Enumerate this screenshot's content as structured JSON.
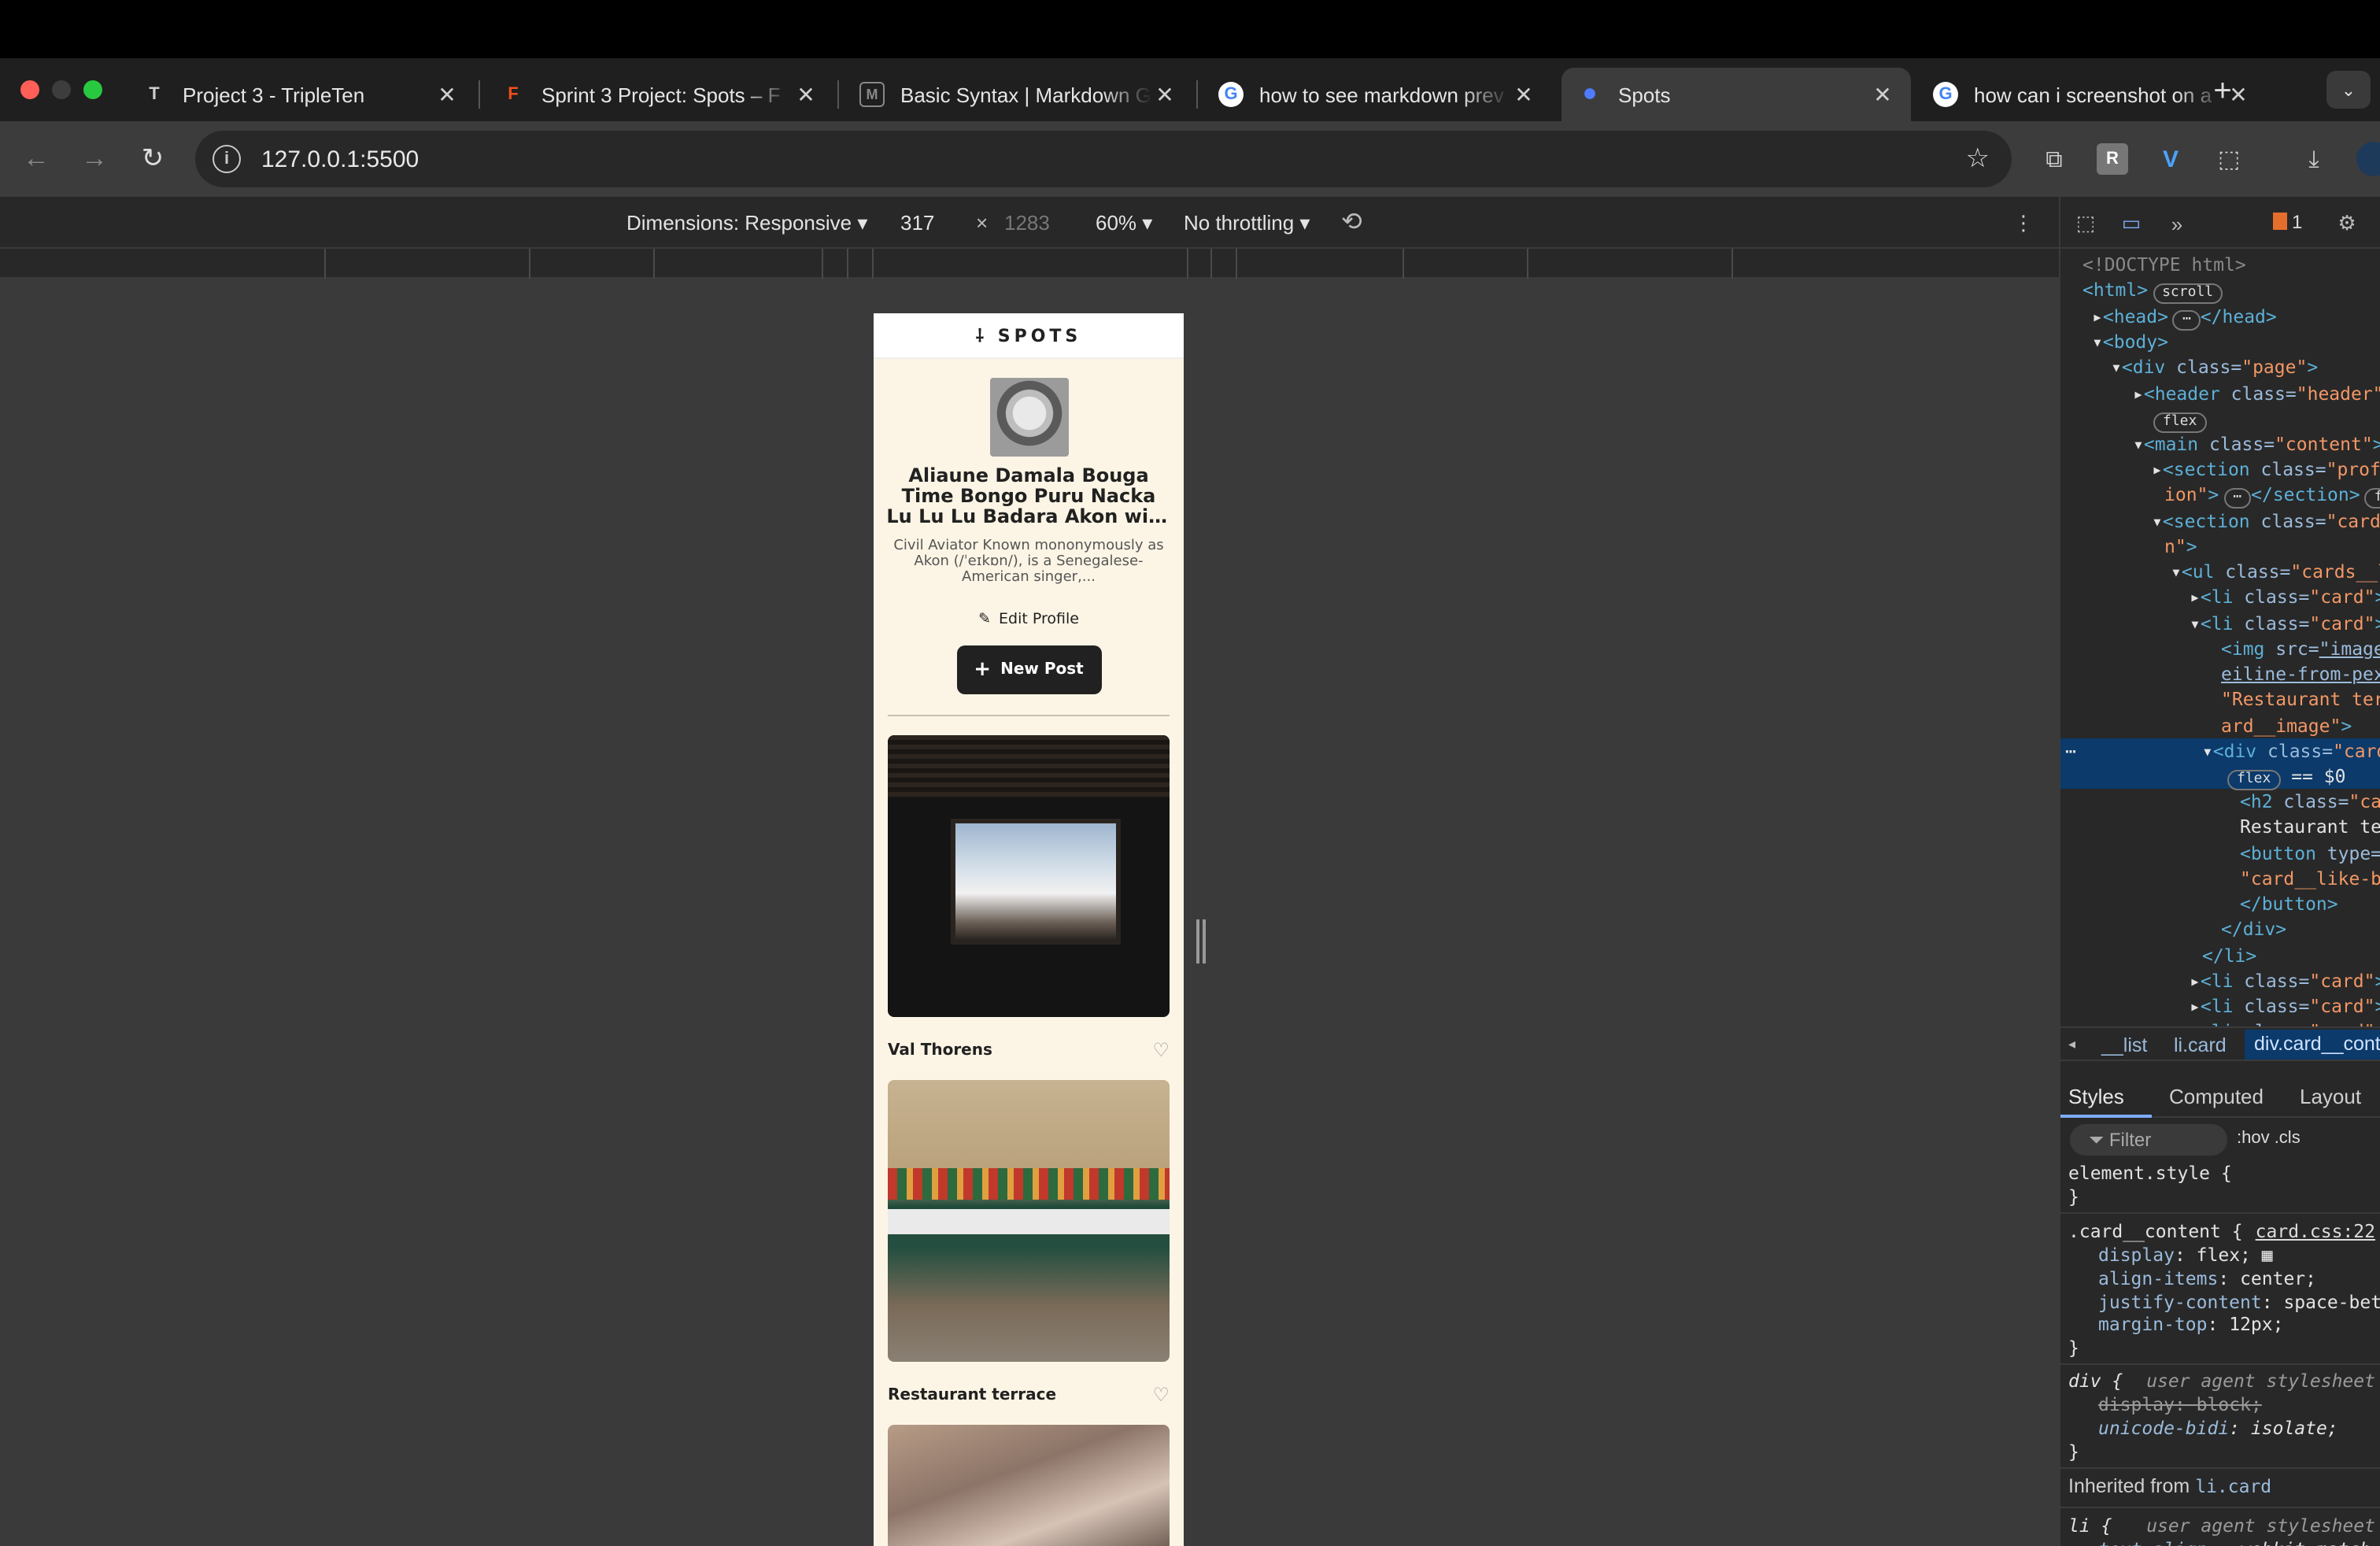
{
  "browser": {
    "tabs": [
      {
        "title": "Project 3 - TripleTen",
        "favicon": "T",
        "favicon_color": "#cfcfcf"
      },
      {
        "title": "Sprint 3 Project: Spots – F",
        "favicon": "F",
        "favicon_color": "#f24e1e"
      },
      {
        "title": "Basic Syntax | Markdown G",
        "favicon": "M",
        "favicon_color": "#888888"
      },
      {
        "title": "how to see markdown prev",
        "favicon": "G",
        "favicon_color": "#4285f4"
      },
      {
        "title": "Spots",
        "favicon": "●",
        "favicon_color": "#4f7cff"
      },
      {
        "title": "how can i screenshot on a",
        "favicon": "G",
        "favicon_color": "#4285f4"
      }
    ],
    "new_tab": "+",
    "url": "127.0.0.1:5500"
  },
  "device_toolbar": {
    "dimensions_label": "Dimensions: Responsive ▾",
    "width": "317",
    "times": "×",
    "height": "1283",
    "zoom": "60% ▾",
    "throttling": "No throttling ▾"
  },
  "site": {
    "logo": "SPOTS",
    "profile_name": "Aliaune Damala Bouga Time Bongo Puru Nacka Lu Lu Lu Badara Akon with a...",
    "profile_desc": "Civil Aviator Known mononymously as Akon (/ˈeɪkɒn/), is a Senegalese-American singer,...",
    "edit_profile": "Edit Profile",
    "new_post": "New Post",
    "cards": [
      {
        "title": "Val Thorens"
      },
      {
        "title": "Restaurant terrace"
      }
    ]
  },
  "devtools": {
    "issues_count": "1",
    "dom_lines": [
      "<!DOCTYPE html>"
    ],
    "breadcrumbs": [
      "__list",
      "li.card",
      "div.card__content"
    ],
    "style_tabs": [
      "Styles",
      "Computed",
      "Layout"
    ],
    "filter_placeholder": "Filter",
    "filter_opts": ":hov  .cls",
    "rules": {
      "element_style": "element.style {",
      "card_selector": ".card__content {",
      "card_src": "card.css:22",
      "card_props": [
        {
          "p": "display",
          "v": "flex;"
        },
        {
          "p": "align-items",
          "v": "center;"
        },
        {
          "p": "justify-content",
          "v": "space-between;"
        },
        {
          "p": "margin-top",
          "v": "12px;"
        }
      ],
      "div_selector": "div {",
      "ua_label": "user agent stylesheet",
      "div_props": [
        {
          "p": "display",
          "v": "block;",
          "strike": true
        },
        {
          "p": "unicode-bidi",
          "v": "isolate;"
        }
      ],
      "inherited_label": "Inherited from",
      "inherited_from": "li.card",
      "li_selector": "li {",
      "li_props": [
        {
          "p": "text-align",
          "v": "-webkit-match-parent;"
        }
      ]
    }
  }
}
